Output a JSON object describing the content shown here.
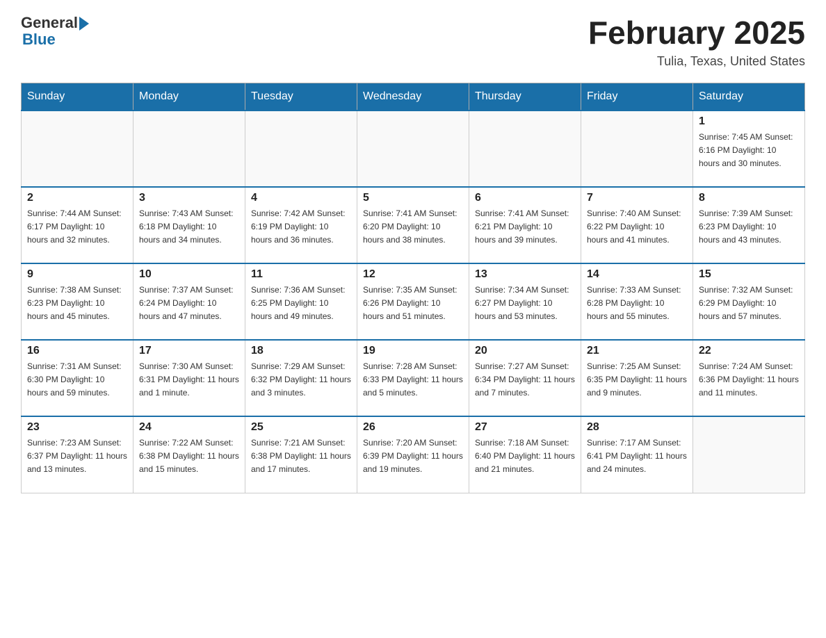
{
  "header": {
    "logo_general": "General",
    "logo_blue": "Blue",
    "month_title": "February 2025",
    "location": "Tulia, Texas, United States"
  },
  "days_of_week": [
    "Sunday",
    "Monday",
    "Tuesday",
    "Wednesday",
    "Thursday",
    "Friday",
    "Saturday"
  ],
  "weeks": [
    [
      {
        "day": "",
        "info": ""
      },
      {
        "day": "",
        "info": ""
      },
      {
        "day": "",
        "info": ""
      },
      {
        "day": "",
        "info": ""
      },
      {
        "day": "",
        "info": ""
      },
      {
        "day": "",
        "info": ""
      },
      {
        "day": "1",
        "info": "Sunrise: 7:45 AM\nSunset: 6:16 PM\nDaylight: 10 hours and 30 minutes."
      }
    ],
    [
      {
        "day": "2",
        "info": "Sunrise: 7:44 AM\nSunset: 6:17 PM\nDaylight: 10 hours and 32 minutes."
      },
      {
        "day": "3",
        "info": "Sunrise: 7:43 AM\nSunset: 6:18 PM\nDaylight: 10 hours and 34 minutes."
      },
      {
        "day": "4",
        "info": "Sunrise: 7:42 AM\nSunset: 6:19 PM\nDaylight: 10 hours and 36 minutes."
      },
      {
        "day": "5",
        "info": "Sunrise: 7:41 AM\nSunset: 6:20 PM\nDaylight: 10 hours and 38 minutes."
      },
      {
        "day": "6",
        "info": "Sunrise: 7:41 AM\nSunset: 6:21 PM\nDaylight: 10 hours and 39 minutes."
      },
      {
        "day": "7",
        "info": "Sunrise: 7:40 AM\nSunset: 6:22 PM\nDaylight: 10 hours and 41 minutes."
      },
      {
        "day": "8",
        "info": "Sunrise: 7:39 AM\nSunset: 6:23 PM\nDaylight: 10 hours and 43 minutes."
      }
    ],
    [
      {
        "day": "9",
        "info": "Sunrise: 7:38 AM\nSunset: 6:23 PM\nDaylight: 10 hours and 45 minutes."
      },
      {
        "day": "10",
        "info": "Sunrise: 7:37 AM\nSunset: 6:24 PM\nDaylight: 10 hours and 47 minutes."
      },
      {
        "day": "11",
        "info": "Sunrise: 7:36 AM\nSunset: 6:25 PM\nDaylight: 10 hours and 49 minutes."
      },
      {
        "day": "12",
        "info": "Sunrise: 7:35 AM\nSunset: 6:26 PM\nDaylight: 10 hours and 51 minutes."
      },
      {
        "day": "13",
        "info": "Sunrise: 7:34 AM\nSunset: 6:27 PM\nDaylight: 10 hours and 53 minutes."
      },
      {
        "day": "14",
        "info": "Sunrise: 7:33 AM\nSunset: 6:28 PM\nDaylight: 10 hours and 55 minutes."
      },
      {
        "day": "15",
        "info": "Sunrise: 7:32 AM\nSunset: 6:29 PM\nDaylight: 10 hours and 57 minutes."
      }
    ],
    [
      {
        "day": "16",
        "info": "Sunrise: 7:31 AM\nSunset: 6:30 PM\nDaylight: 10 hours and 59 minutes."
      },
      {
        "day": "17",
        "info": "Sunrise: 7:30 AM\nSunset: 6:31 PM\nDaylight: 11 hours and 1 minute."
      },
      {
        "day": "18",
        "info": "Sunrise: 7:29 AM\nSunset: 6:32 PM\nDaylight: 11 hours and 3 minutes."
      },
      {
        "day": "19",
        "info": "Sunrise: 7:28 AM\nSunset: 6:33 PM\nDaylight: 11 hours and 5 minutes."
      },
      {
        "day": "20",
        "info": "Sunrise: 7:27 AM\nSunset: 6:34 PM\nDaylight: 11 hours and 7 minutes."
      },
      {
        "day": "21",
        "info": "Sunrise: 7:25 AM\nSunset: 6:35 PM\nDaylight: 11 hours and 9 minutes."
      },
      {
        "day": "22",
        "info": "Sunrise: 7:24 AM\nSunset: 6:36 PM\nDaylight: 11 hours and 11 minutes."
      }
    ],
    [
      {
        "day": "23",
        "info": "Sunrise: 7:23 AM\nSunset: 6:37 PM\nDaylight: 11 hours and 13 minutes."
      },
      {
        "day": "24",
        "info": "Sunrise: 7:22 AM\nSunset: 6:38 PM\nDaylight: 11 hours and 15 minutes."
      },
      {
        "day": "25",
        "info": "Sunrise: 7:21 AM\nSunset: 6:38 PM\nDaylight: 11 hours and 17 minutes."
      },
      {
        "day": "26",
        "info": "Sunrise: 7:20 AM\nSunset: 6:39 PM\nDaylight: 11 hours and 19 minutes."
      },
      {
        "day": "27",
        "info": "Sunrise: 7:18 AM\nSunset: 6:40 PM\nDaylight: 11 hours and 21 minutes."
      },
      {
        "day": "28",
        "info": "Sunrise: 7:17 AM\nSunset: 6:41 PM\nDaylight: 11 hours and 24 minutes."
      },
      {
        "day": "",
        "info": ""
      }
    ]
  ]
}
